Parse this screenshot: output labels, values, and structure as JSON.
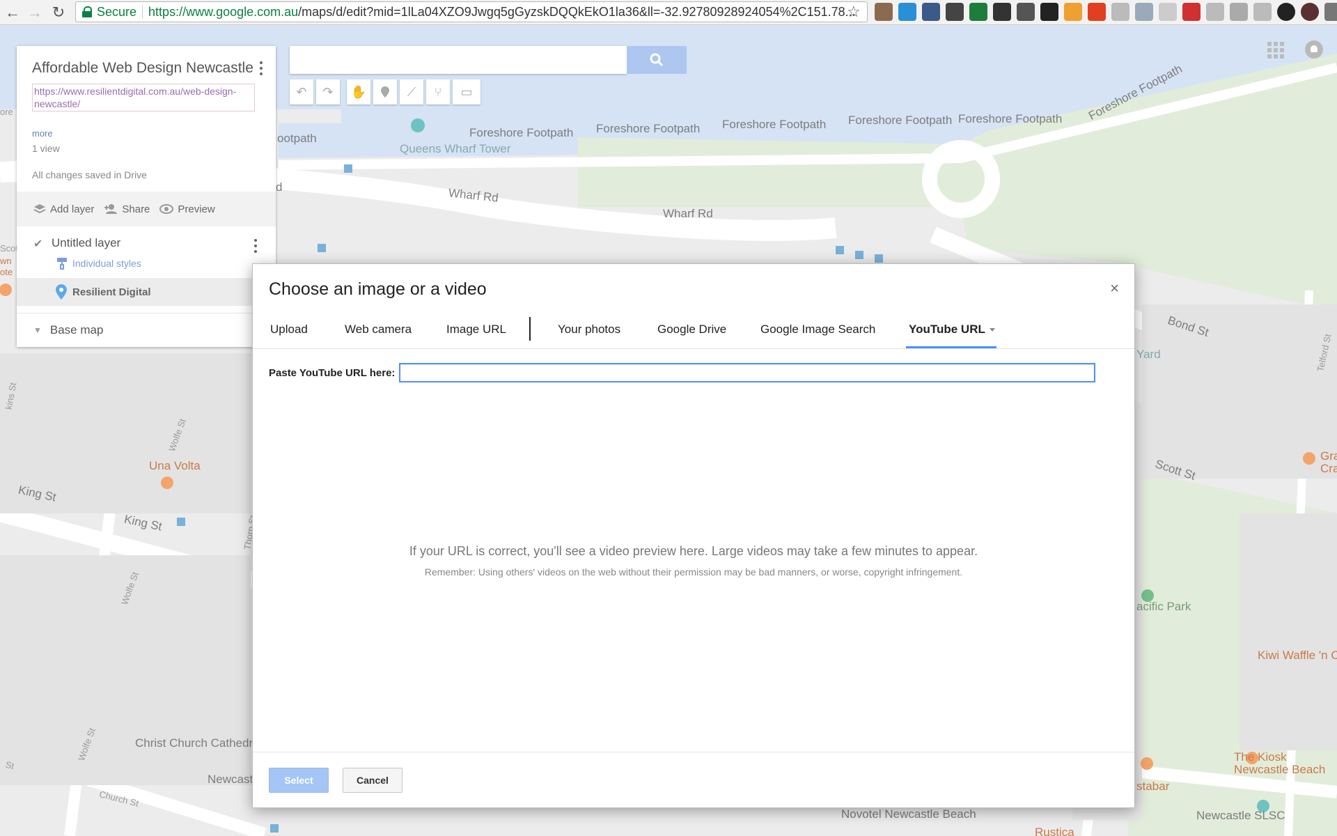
{
  "browser": {
    "secure_label": "Secure",
    "url_domain": "https://www.google.com.au",
    "url_path": "/maps/d/edit?mid=1lLa04XZO9Jwgq5gGyzskDQQkEkO1la36&ll=-32.92780928924054%2C151.78..."
  },
  "panel": {
    "title": "Affordable Web Design Newcastle",
    "description": "https://www.resilientdigital.com.au/web-design-newcastle/",
    "more": "more",
    "views": "1 view",
    "save_status": "All changes saved in Drive",
    "actions": {
      "add_layer": "Add layer",
      "share": "Share",
      "preview": "Preview"
    },
    "layer": {
      "name": "Untitled layer",
      "styles": "Individual styles",
      "feature": "Resilient Digital"
    },
    "base_map": "Base map"
  },
  "map_labels": {
    "foreshore_1": "Foreshore Footpath",
    "foreshore_2": "Foreshore Footpath",
    "foreshore_3": "Foreshore Footpath",
    "foreshore_4": "Foreshore Footpath",
    "foreshore_5": "Foreshore Footpath",
    "foreshore_6": "Foreshore Footpath",
    "footpath_left": "ootpath",
    "queens_wharf": "Queens Wharf Tower",
    "wharf_rd_1": "Wharf Rd",
    "wharf_rd_2": "Wharf Rd",
    "bond_st": "Bond St",
    "scott_st": "Scott St",
    "king_st_1": "King St",
    "king_st_2": "King St",
    "una_volta": "Una Volta",
    "christ_church": "Christ Church Cathedr",
    "pacific_park": "acific Park",
    "kiwi_waffle": "Kiwi Waffle 'n C",
    "kiosk": "The Kiosk",
    "kiosk_2": "Newcastle Beach",
    "slsc": "Newcastle SLSC",
    "novotel": "Novotel Newcastle Beach",
    "yard": "Yard",
    "newcast": "Newcast",
    "church_st": "Church St",
    "wolfe_st_1": "Wolfe St",
    "wolfe_st_2": "Wolfe St",
    "wolfe_st_3": "Wolfe St",
    "thorn_st": "Thorn St",
    "telford_st": "Telford St",
    "gra": "Gra",
    "cra": "Cra",
    "stabar": "stabar",
    "rustica": "Rustica",
    "scot": "Scot",
    "wn": "wn",
    "ote": "ote",
    "ore": "ore",
    "d_left": "d",
    "kins_st": "kins St",
    "st_left": "St"
  },
  "dialog": {
    "title": "Choose an image or a video",
    "close": "×",
    "tabs": [
      "Upload",
      "Web camera",
      "Image URL",
      "Your photos",
      "Google Drive",
      "Google Image Search",
      "YouTube URL"
    ],
    "url_label": "Paste YouTube URL here:",
    "url_value": "",
    "preview_message": "If your URL is correct, you'll see a video preview here. Large videos may take a few minutes to appear.",
    "preview_note": "Remember: Using others' videos on the web without their permission may be bad manners, or worse, copyright infringement.",
    "select": "Select",
    "cancel": "Cancel"
  }
}
